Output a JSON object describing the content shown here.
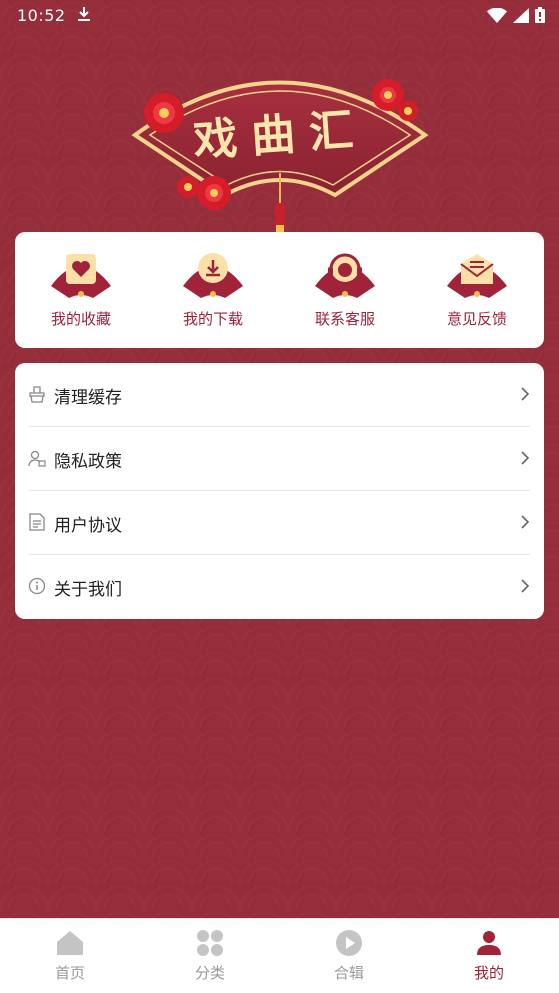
{
  "status_bar": {
    "time": "10:52"
  },
  "header": {
    "title": "戏曲汇"
  },
  "quick_actions": [
    {
      "label": "我的收藏",
      "icon": "heart-envelope-icon"
    },
    {
      "label": "我的下载",
      "icon": "download-icon"
    },
    {
      "label": "联系客服",
      "icon": "headset-icon"
    },
    {
      "label": "意见反馈",
      "icon": "mail-icon"
    }
  ],
  "settings": [
    {
      "label": "清理缓存",
      "icon": "broom-icon"
    },
    {
      "label": "隐私政策",
      "icon": "user-lock-icon"
    },
    {
      "label": "用户协议",
      "icon": "document-icon"
    },
    {
      "label": "关于我们",
      "icon": "info-icon"
    }
  ],
  "bottom_nav": [
    {
      "label": "首页",
      "icon": "home-icon",
      "active": false
    },
    {
      "label": "分类",
      "icon": "grid-icon",
      "active": false
    },
    {
      "label": "合辑",
      "icon": "play-icon",
      "active": false
    },
    {
      "label": "我的",
      "icon": "profile-icon",
      "active": true
    }
  ],
  "colors": {
    "background": "#962d3b",
    "accent": "#a0233a",
    "gold": "#fbe6ae",
    "inactive": "#9a9a9a"
  }
}
